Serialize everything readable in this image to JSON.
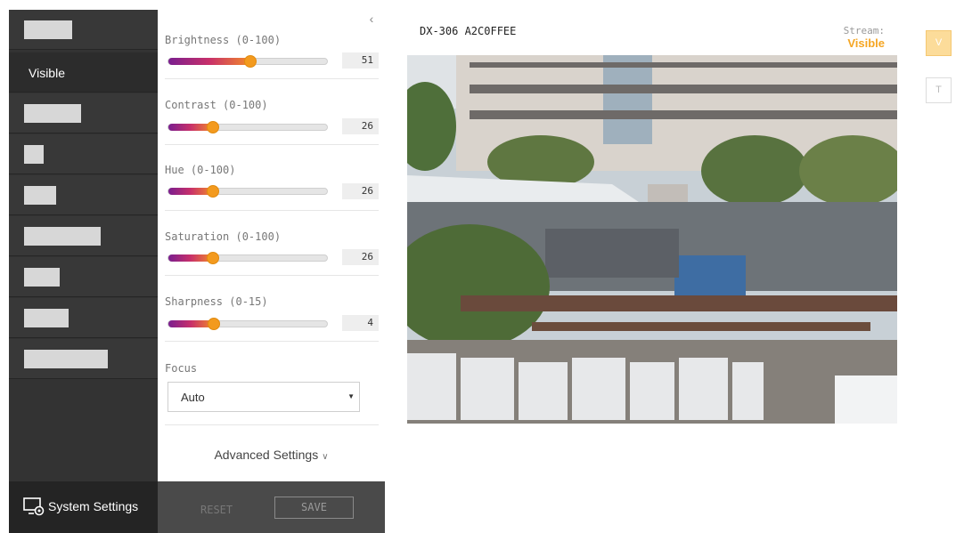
{
  "sidebar": {
    "active_item": "Visible",
    "system_settings_label": "System Settings"
  },
  "panel": {
    "sliders": [
      {
        "label": "Brightness (0-100)",
        "value": "51",
        "level": 51,
        "max": 100
      },
      {
        "label": "Contrast (0-100)",
        "value": "26",
        "level": 26,
        "max": 100
      },
      {
        "label": "Hue (0-100)",
        "value": "26",
        "level": 26,
        "max": 100
      },
      {
        "label": "Saturation (0-100)",
        "value": "26",
        "level": 26,
        "max": 100
      },
      {
        "label": "Sharpness (0-15)",
        "value": "4",
        "level": 4,
        "max": 15
      }
    ],
    "focus": {
      "label": "Focus",
      "value": "Auto"
    },
    "advanced_label": "Advanced Settings",
    "reset_label": "RESET",
    "save_label": "SAVE"
  },
  "main": {
    "camera_title": "DX-306 A2C0FFEE",
    "stream_label": "Stream:",
    "stream_value": "Visible",
    "v_button": "V",
    "t_button": "T"
  },
  "colors": {
    "accent": "#f5a623",
    "sidebar_bg": "#333333",
    "footer_bg": "#4a4a4a"
  }
}
